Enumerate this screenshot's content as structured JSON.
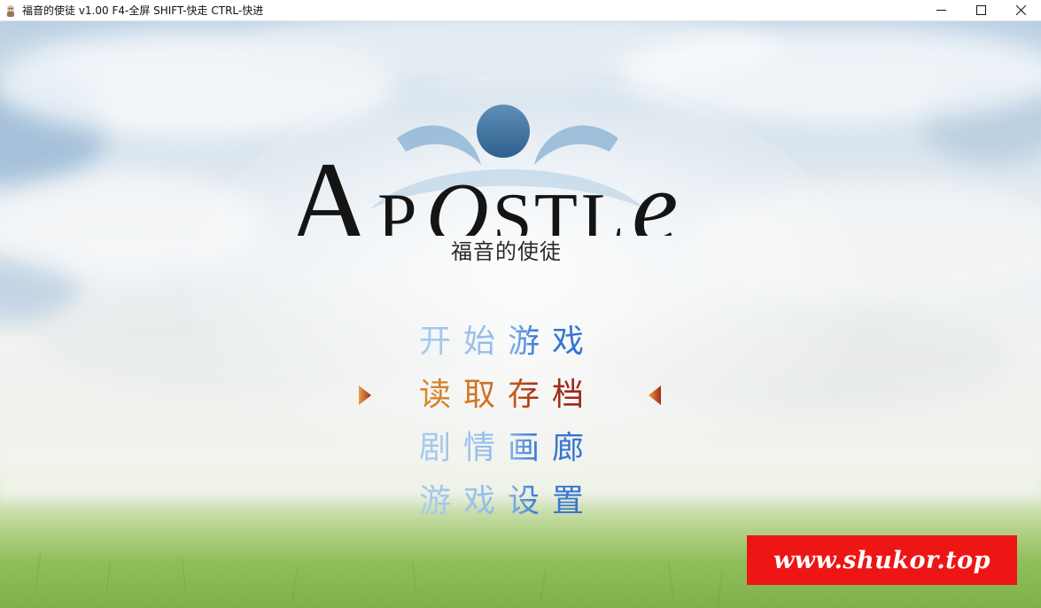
{
  "window": {
    "title": "福音的使徒 v1.00 F4-全屏 SHIFT-快走 CTRL-快进",
    "controls": [
      "minimize-icon",
      "maximize-icon",
      "close-icon"
    ]
  },
  "logo": {
    "wordmark": "APOSTLe",
    "subtitle": "福音的使徒"
  },
  "menu": {
    "items": [
      {
        "label": "开始游戏",
        "selected": false
      },
      {
        "label": "读取存档",
        "selected": true
      },
      {
        "label": "剧情画廊",
        "selected": false
      },
      {
        "label": "游戏设置",
        "selected": false
      }
    ],
    "selection_indicator_icons": [
      "triangle-right-icon",
      "triangle-left-icon"
    ]
  },
  "watermark": {
    "text": "www.shukor.top"
  },
  "colors": {
    "menu_normal": "#3d7bd8",
    "menu_light": "#a9cbf0",
    "menu_selected": "#a8321a",
    "menu_selected_light": "#d98a2c",
    "watermark_bg": "#ee1515",
    "logo_ring": "#4a7ca8"
  }
}
